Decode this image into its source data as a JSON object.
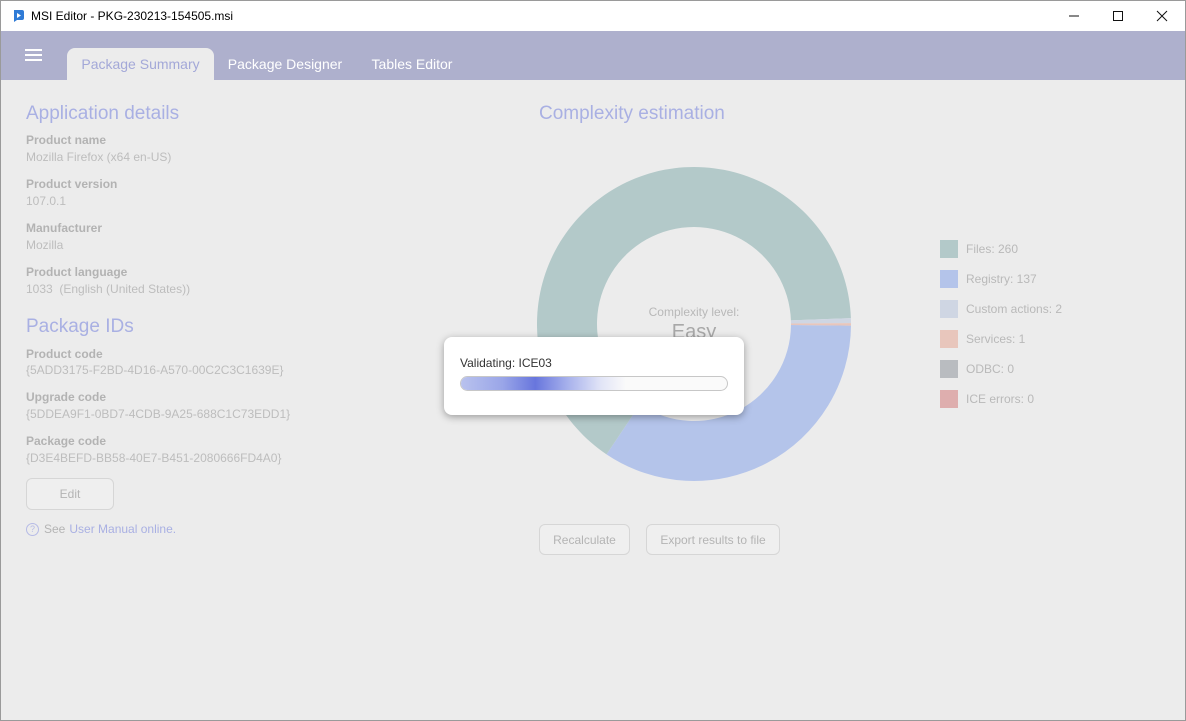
{
  "window": {
    "title": "MSI Editor - PKG-230213-154505.msi",
    "app_icon": "msi-editor-logo-icon",
    "minimize_icon": "minimize-icon",
    "maximize_icon": "maximize-icon",
    "close_icon": "close-icon"
  },
  "tabs": [
    {
      "label": "Package Summary",
      "active": true
    },
    {
      "label": "Package Designer",
      "active": false
    },
    {
      "label": "Tables Editor",
      "active": false
    }
  ],
  "menu_icon": "hamburger-menu-icon",
  "app_details": {
    "title": "Application details",
    "fields": [
      {
        "label": "Product name",
        "value": "Mozilla Firefox (x64 en-US)"
      },
      {
        "label": "Product version",
        "value": "107.0.1"
      },
      {
        "label": "Manufacturer",
        "value": "Mozilla"
      },
      {
        "label": "Product language",
        "value": "1033  (English (United States))"
      }
    ]
  },
  "package_ids": {
    "title": "Package IDs",
    "fields": [
      {
        "label": "Product code",
        "value": "{5ADD3175-F2BD-4D16-A570-00C2C3C1639E}"
      },
      {
        "label": "Upgrade code",
        "value": "{5DDEA9F1-0BD7-4CDB-9A25-688C1C73EDD1}"
      },
      {
        "label": "Package code",
        "value": "{D3E4BEFD-BB58-40E7-B451-2080666FD4A0}"
      }
    ],
    "edit_label": "Edit"
  },
  "help": {
    "prefix": "See",
    "link": "User Manual online."
  },
  "complexity": {
    "title": "Complexity estimation",
    "center_label": "Complexity level:",
    "center_value": "Easy",
    "recalculate_label": "Recalculate",
    "export_label": "Export results to file"
  },
  "legend": [
    {
      "text": "Files: 260",
      "color": "#b3c9c9"
    },
    {
      "text": "Registry: 137",
      "color": "#b4c4ea"
    },
    {
      "text": "Custom actions: 2",
      "color": "#cfd6e3"
    },
    {
      "text": "Services: 1",
      "color": "#e8c6bc"
    },
    {
      "text": "ODBC: 0",
      "color": "#b9bcc0"
    },
    {
      "text": "ICE errors: 0",
      "color": "#deaeae"
    }
  ],
  "chart_data": {
    "type": "pie",
    "categories": [
      "Files",
      "Registry",
      "Custom actions",
      "Services",
      "ODBC",
      "ICE errors"
    ],
    "values": [
      260,
      137,
      2,
      1,
      0,
      0
    ],
    "colors": [
      "#b3c9c9",
      "#b4c4ea",
      "#cfd6e3",
      "#e8c6bc",
      "#b9bcc0",
      "#deaeae"
    ]
  },
  "dialog": {
    "text": "Validating: ICE03",
    "progress": 0.62
  }
}
